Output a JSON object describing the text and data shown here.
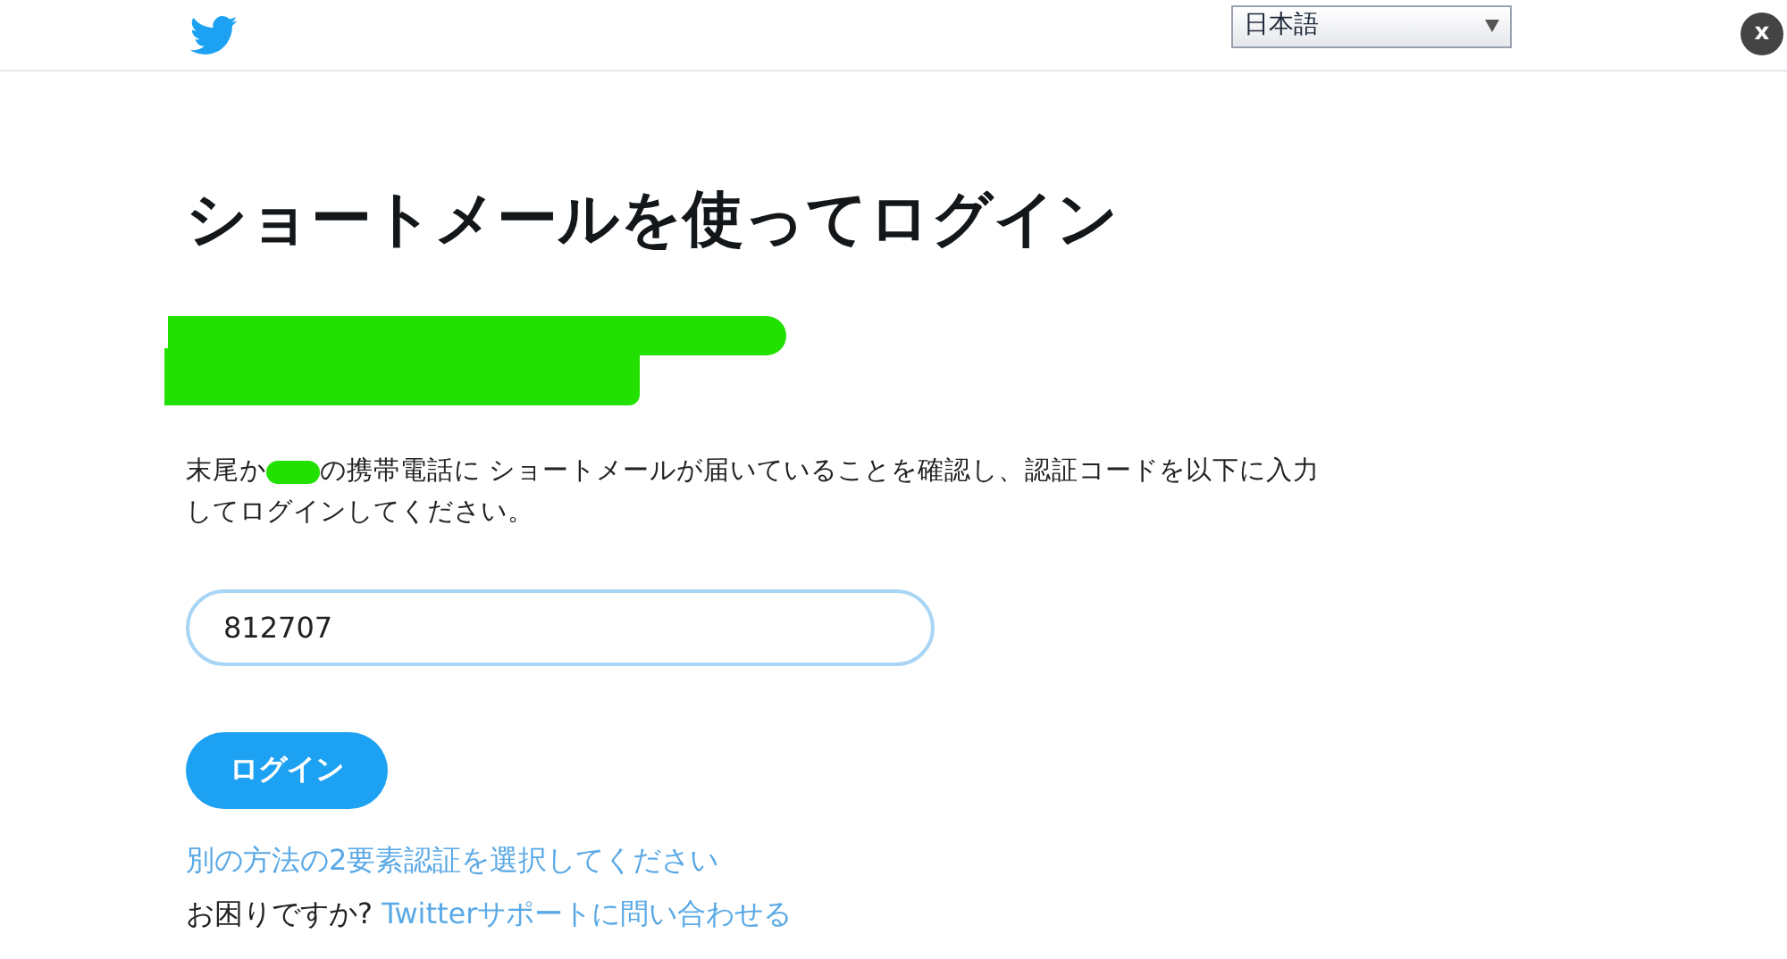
{
  "header": {
    "language": "日本語",
    "close": "x"
  },
  "title": "ショートメールを使ってログイン",
  "message": {
    "before": "末尾か",
    "after": "の携帯電話に ショートメールが届いていることを確認し、認証コードを以下に入力",
    "continued": "してログインしてください。"
  },
  "code_field": {
    "value": "812707"
  },
  "login_button": "ログイン",
  "alternate_link": "別の方法の2要素認証を選択してください",
  "help": {
    "text": "お困りですか?",
    "link": "Twitterサポートに問い合わせる"
  }
}
